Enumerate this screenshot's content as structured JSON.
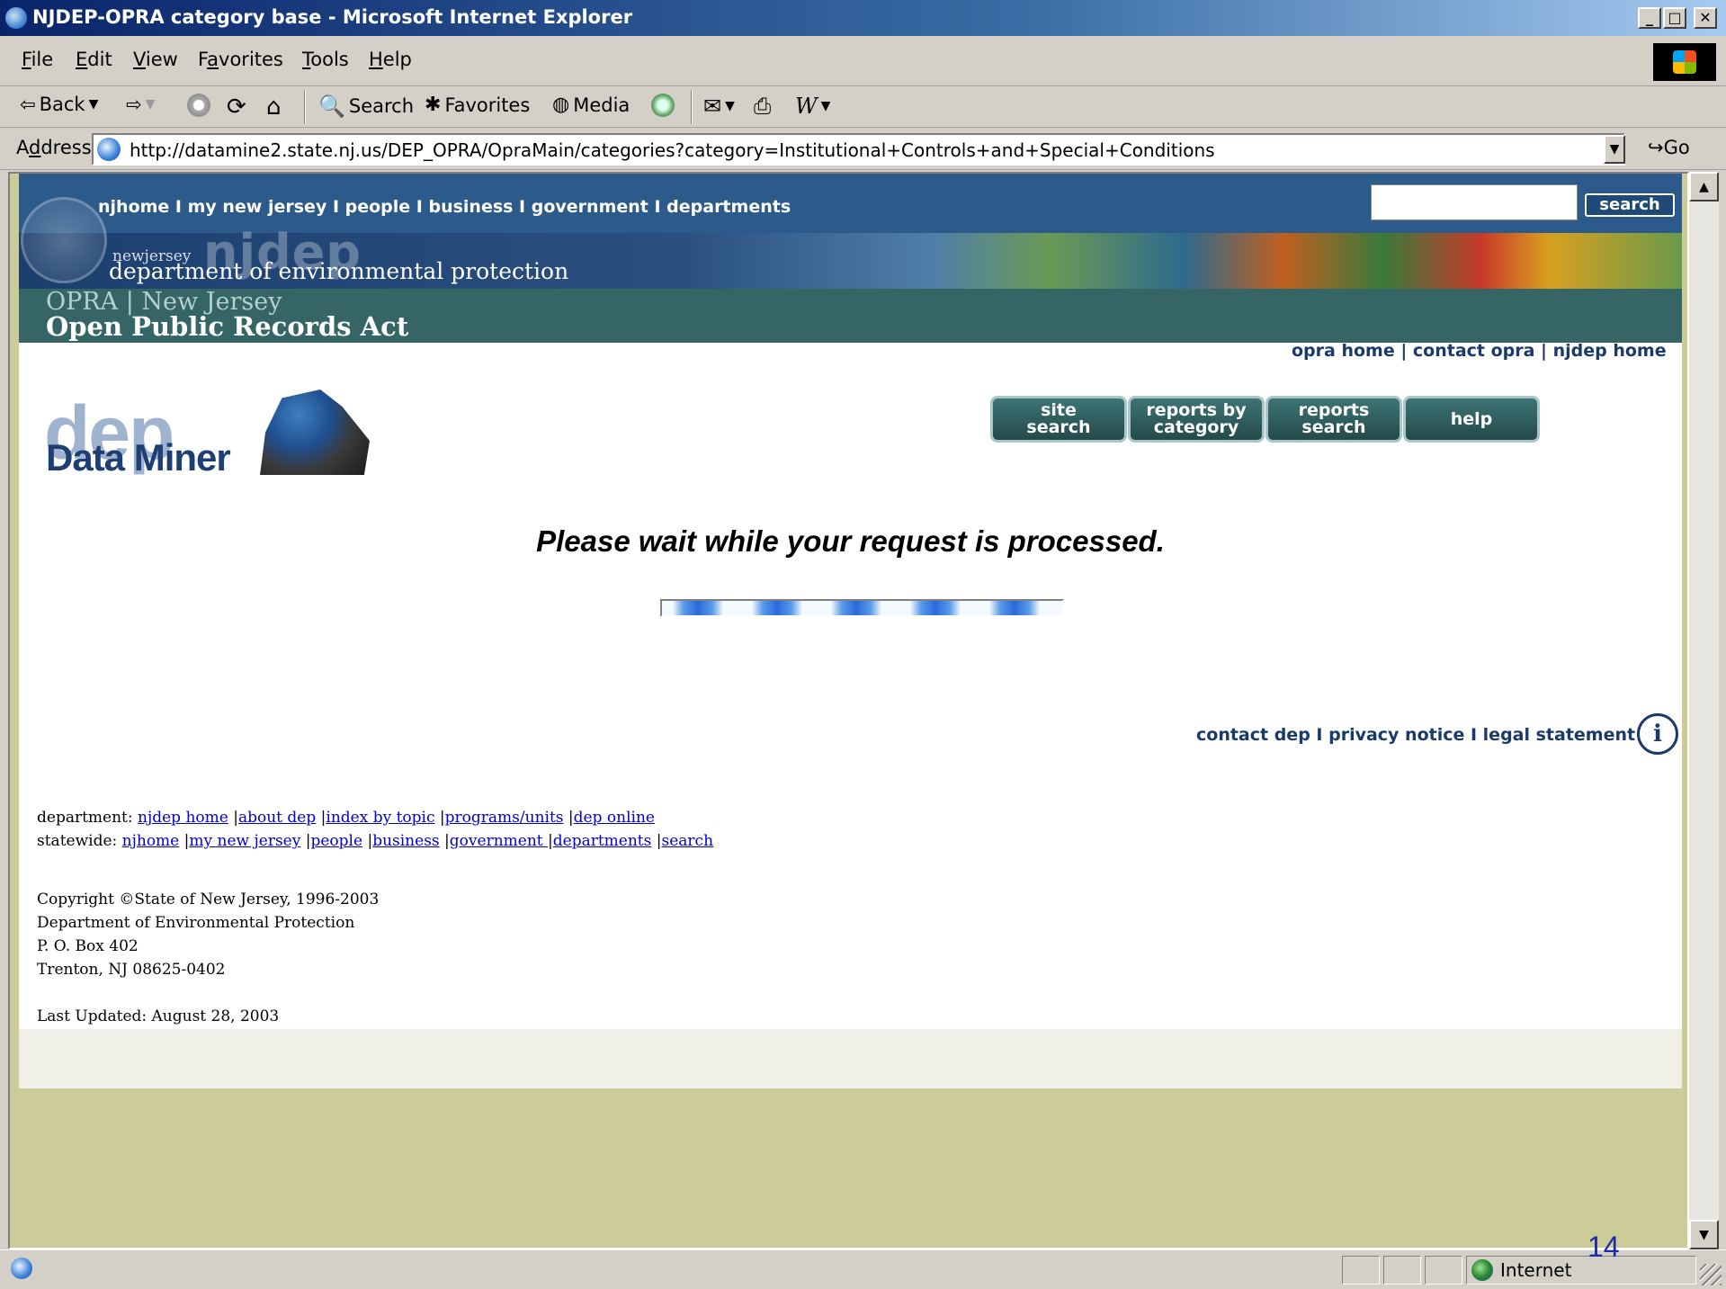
{
  "window": {
    "title": "NJDEP-OPRA category base - Microsoft Internet Explorer"
  },
  "menu": [
    {
      "pre": "",
      "key": "F",
      "rest": "ile"
    },
    {
      "pre": "",
      "key": "E",
      "rest": "dit"
    },
    {
      "pre": "",
      "key": "V",
      "rest": "iew"
    },
    {
      "pre": "F",
      "key": "a",
      "rest": "vorites"
    },
    {
      "pre": "",
      "key": "T",
      "rest": "ools"
    },
    {
      "pre": "",
      "key": "H",
      "rest": "elp"
    }
  ],
  "toolbar": {
    "back": "Back",
    "search": "Search",
    "favorites": "Favorites",
    "media": "Media"
  },
  "address": {
    "label_pre": "A",
    "label_key": "d",
    "label_rest": "dress",
    "url": "http://datamine2.state.nj.us/DEP_OPRA/OpraMain/categories?category=Institutional+Controls+and+Special+Conditions",
    "go": "Go"
  },
  "nj_header": {
    "nav": "njhome  I  my new jersey  I  people  I  business  I  government  I  departments",
    "search_button": "search",
    "nj_small": "newjersey",
    "njdep": "njdep",
    "dept_name": "department of environmental protection",
    "opra_line1": "OPRA | New Jersey",
    "opra_line2": "Open Public Records Act"
  },
  "opra_links": "opra home  |  contact opra  |  njdep home",
  "logo": {
    "dep": "dep",
    "data_miner": "Data Miner"
  },
  "nav_buttons": [
    {
      "line1": "site",
      "line2": "search"
    },
    {
      "line1": "reports by",
      "line2": "category"
    },
    {
      "line1": "reports",
      "line2": "search"
    },
    {
      "line1": "help",
      "line2": ""
    }
  ],
  "wait_message": "Please wait while your request is processed.",
  "footer_links": "contact dep I privacy notice I legal statement",
  "department_row": {
    "label": "department:",
    "links": [
      "njdep home",
      "about dep",
      "index by topic",
      "programs/units",
      "dep online"
    ]
  },
  "statewide_row": {
    "label": "statewide:",
    "links": [
      "njhome",
      "my new jersey",
      "people",
      "business",
      "government ",
      "departments",
      "search"
    ]
  },
  "copyright": [
    "Copyright ©State of New Jersey, 1996-2003",
    "Department of Environmental Protection",
    "P. O. Box 402",
    "Trenton, NJ 08625-0402"
  ],
  "last_updated": "Last Updated: August 28, 2003",
  "status": {
    "zone": "Internet"
  },
  "slide_number": "14"
}
